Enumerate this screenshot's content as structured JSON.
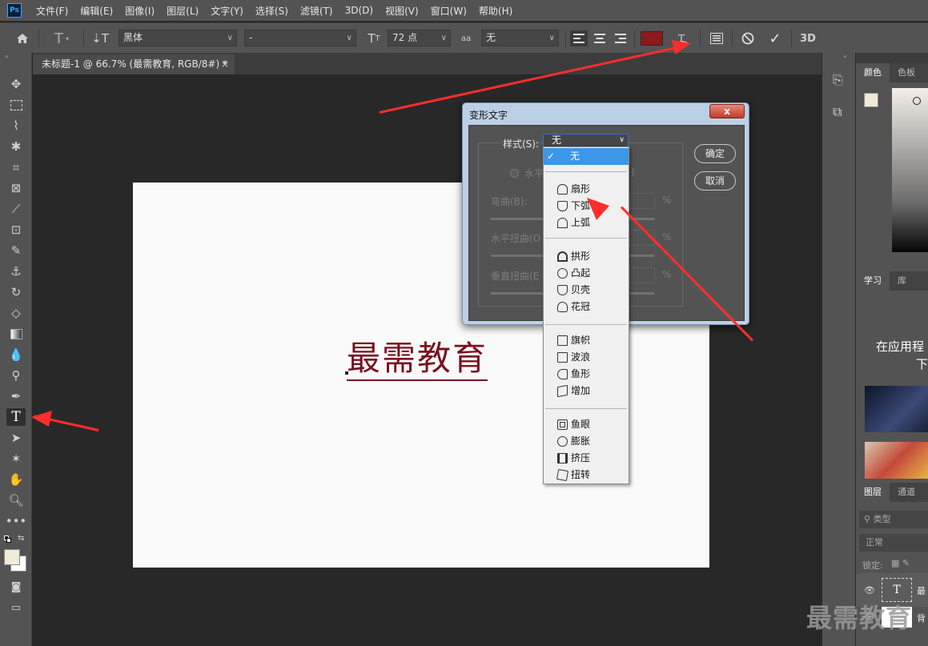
{
  "app": {
    "logo": "Ps"
  },
  "menubar": {
    "items": [
      "文件(F)",
      "编辑(E)",
      "图像(I)",
      "图层(L)",
      "文字(Y)",
      "选择(S)",
      "滤镜(T)",
      "3D(D)",
      "视图(V)",
      "窗口(W)",
      "帮助(H)"
    ]
  },
  "options": {
    "font_family": "黑体",
    "font_style": "-",
    "font_size": "72 点",
    "antialias_icon": "aa",
    "antialias": "无",
    "three_d": "3D",
    "text_color": "#8b1a1a"
  },
  "document": {
    "tab_title": "未标题-1 @ 66.7% (最需教育, RGB/8#) *",
    "close": "×",
    "canvas_text": "最需教育"
  },
  "dialog": {
    "title": "变形文字",
    "close": "x",
    "style_label": "样式(S):",
    "style_value": "无",
    "horizontal_partial": "水平",
    "vertical_partial": ")",
    "bend_label": "弯曲(B):",
    "hdist_label": "水平扭曲(O",
    "vdist_label": "垂直扭曲(E",
    "percent": "%",
    "ok": "确定",
    "cancel": "取消"
  },
  "style_menu": {
    "check": "✓",
    "items": [
      "无",
      "扇形",
      "下弧",
      "上弧",
      "拱形",
      "凸起",
      "贝壳",
      "花冠",
      "旗帜",
      "波浪",
      "鱼形",
      "增加",
      "鱼眼",
      "膨胀",
      "挤压",
      "扭转"
    ]
  },
  "right_panel": {
    "tab_color": "颜色",
    "tab_swatches": "色板",
    "tab_learn": "学习",
    "tab_library": "库",
    "learn_text1": "在应用程",
    "learn_text2": "下",
    "tab_layers": "图层",
    "tab_channels": "通道",
    "kind": "类型",
    "blend": "正常",
    "lock": "锁定:",
    "layer_text_name": "最",
    "layer_bg_name": "背"
  },
  "watermark": "最需教育",
  "colors": {
    "accent": "#3c97e8",
    "arrow": "#ff2d2d",
    "text_color": "#7a1120"
  }
}
